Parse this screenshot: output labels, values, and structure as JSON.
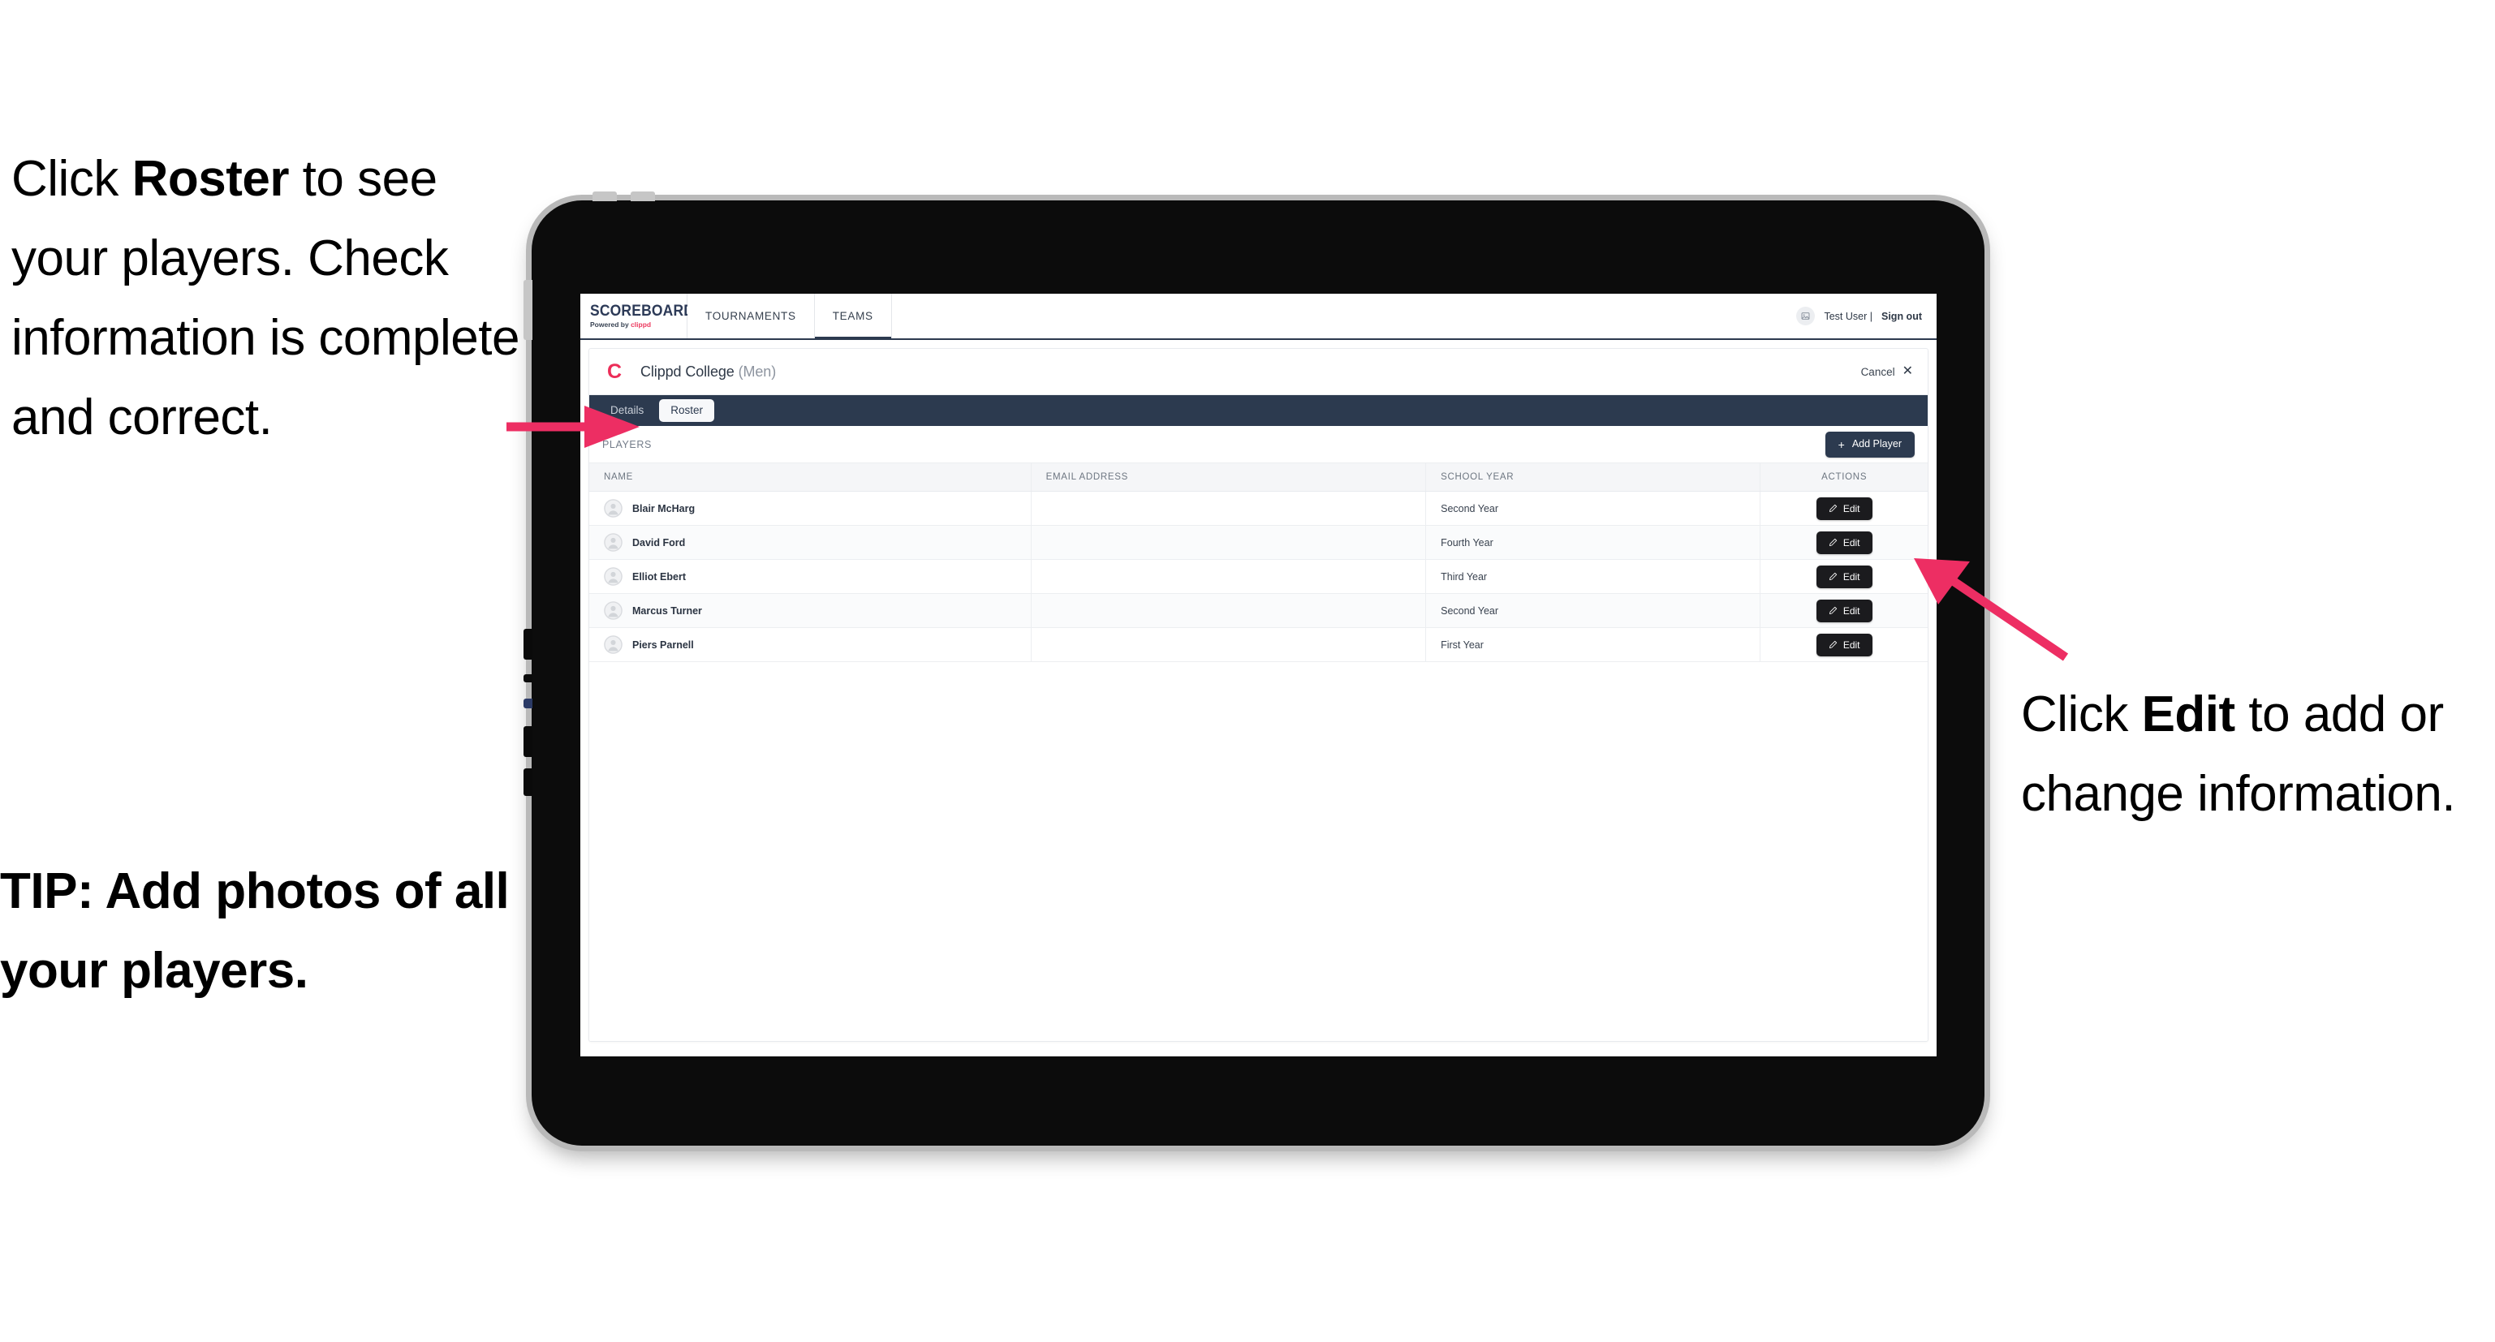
{
  "annotations": {
    "left": {
      "line1_pre": "Click ",
      "line1_bold": "Roster",
      "line1_post": " to see your players. Check information is complete and correct."
    },
    "tip": "TIP: Add photos of all your players.",
    "right": {
      "pre": "Click ",
      "bold": "Edit",
      "post": " to add or change information."
    }
  },
  "colors": {
    "arrow_pink": "#ed2e63",
    "brand_navy": "#2c3a4f",
    "clippd_red": "#ec3a5f",
    "edit_black": "#1b1b1e"
  },
  "app": {
    "topnav": {
      "brand_title": "SCOREBOARD",
      "brand_powered_prefix": "Powered by ",
      "brand_powered_name": "clippd",
      "tabs": [
        {
          "label": "TOURNAMENTS",
          "active": false
        },
        {
          "label": "TEAMS",
          "active": true
        }
      ],
      "user_name": "Test User |",
      "sign_out": "Sign out"
    },
    "team_header": {
      "logo_letter": "C",
      "name": "Clippd College",
      "gender": "(Men)",
      "cancel_label": "Cancel",
      "cancel_icon": "close-icon"
    },
    "subtabs": [
      {
        "label": "Details",
        "active": false
      },
      {
        "label": "Roster",
        "active": true
      }
    ],
    "players_toolbar": {
      "section_label": "PLAYERS",
      "add_player_label": "Add Player",
      "add_player_icon": "plus-icon"
    },
    "table": {
      "columns": [
        "NAME",
        "EMAIL ADDRESS",
        "SCHOOL YEAR",
        "ACTIONS"
      ],
      "rows": [
        {
          "name": "Blair McHarg",
          "email": "",
          "school_year": "Second Year",
          "action": "Edit"
        },
        {
          "name": "David Ford",
          "email": "",
          "school_year": "Fourth Year",
          "action": "Edit"
        },
        {
          "name": "Elliot Ebert",
          "email": "",
          "school_year": "Third Year",
          "action": "Edit"
        },
        {
          "name": "Marcus Turner",
          "email": "",
          "school_year": "Second Year",
          "action": "Edit"
        },
        {
          "name": "Piers Parnell",
          "email": "",
          "school_year": "First Year",
          "action": "Edit"
        }
      ]
    }
  }
}
